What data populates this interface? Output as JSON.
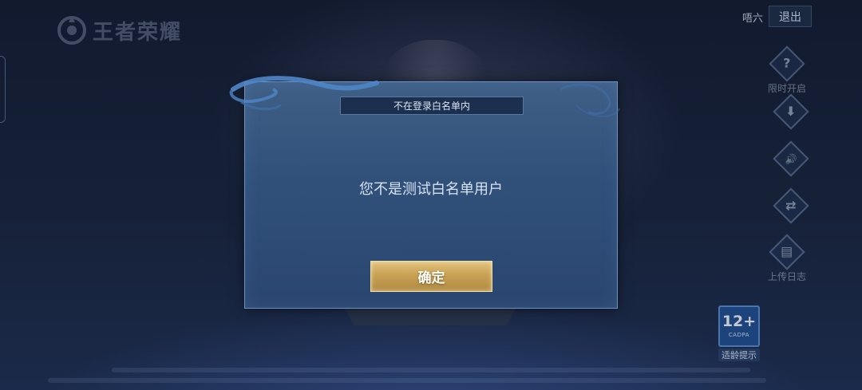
{
  "background": {
    "logo_text": "王者荣耀"
  },
  "header": {
    "user_name": "唔六",
    "logout_label": "退出"
  },
  "side_menu": [
    {
      "label": "限时开启",
      "icon": "question-icon",
      "glyph": "?"
    },
    {
      "label": "",
      "icon": "download-icon",
      "glyph": "⬇"
    },
    {
      "label": "",
      "icon": "speaker-icon",
      "glyph": "🔊"
    },
    {
      "label": "",
      "icon": "phone-switch-icon",
      "glyph": "⇄"
    },
    {
      "label": "上传日志",
      "icon": "clipboard-icon",
      "glyph": "▤"
    }
  ],
  "age_rating": {
    "number": "12+",
    "org": "CADPA",
    "tip": "适龄提示"
  },
  "dialog": {
    "title": "不在登录白名单内",
    "message": "您不是测试白名单用户",
    "confirm_label": "确定"
  },
  "colors": {
    "dialog_bg": "#30507a",
    "confirm_gold": "#c9a155"
  }
}
